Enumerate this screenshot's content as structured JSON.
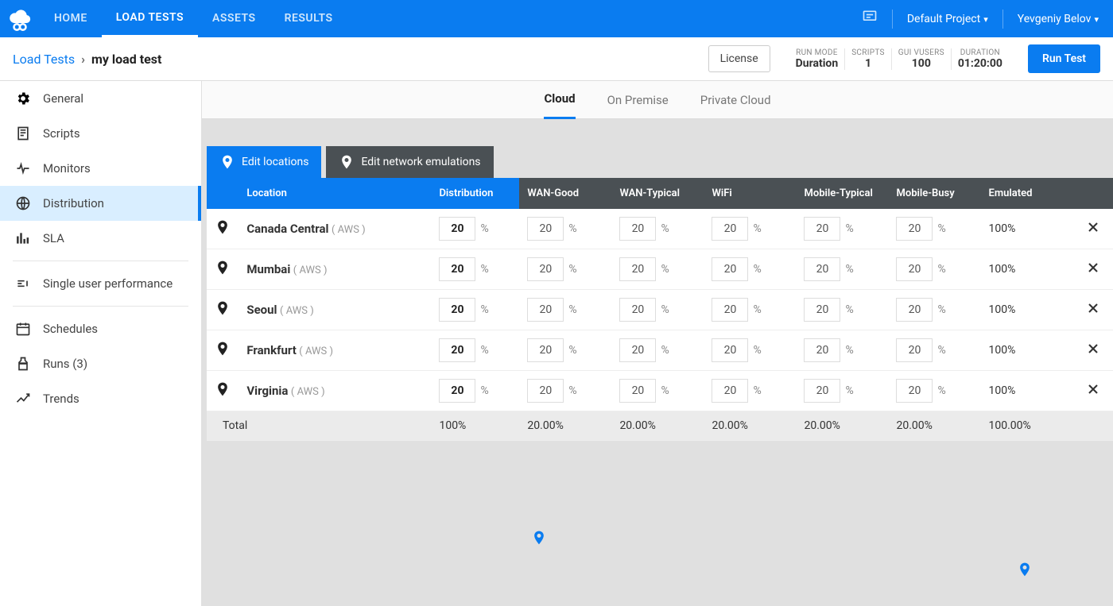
{
  "nav": {
    "items": [
      "HOME",
      "LOAD TESTS",
      "ASSETS",
      "RESULTS"
    ],
    "active": 1,
    "project": "Default Project",
    "user": "Yevgeniy Belov"
  },
  "breadcrumb": {
    "root": "Load Tests",
    "current": "my load test"
  },
  "header": {
    "license": "License",
    "metrics": [
      {
        "label": "RUN MODE",
        "value": "Duration"
      },
      {
        "label": "SCRIPTS",
        "value": "1"
      },
      {
        "label": "GUI VUSERS",
        "value": "100"
      },
      {
        "label": "DURATION",
        "value": "01:20:00"
      }
    ],
    "run": "Run Test"
  },
  "sidebar": {
    "items": [
      {
        "icon": "gear",
        "label": "General"
      },
      {
        "icon": "script",
        "label": "Scripts"
      },
      {
        "icon": "monitor",
        "label": "Monitors"
      },
      {
        "icon": "globe",
        "label": "Distribution"
      },
      {
        "icon": "sla",
        "label": "SLA"
      }
    ],
    "items2": [
      {
        "icon": "single",
        "label": "Single user performance"
      }
    ],
    "items3": [
      {
        "icon": "schedule",
        "label": "Schedules"
      },
      {
        "icon": "runs",
        "label": "Runs (3)"
      },
      {
        "icon": "trends",
        "label": "Trends"
      }
    ],
    "active": 3
  },
  "tabs": {
    "items": [
      "Cloud",
      "On Premise",
      "Private Cloud"
    ],
    "active": 0
  },
  "buttons": {
    "editLocations": "Edit locations",
    "editNetwork": "Edit network emulations"
  },
  "table": {
    "headers": [
      "Location",
      "Distribution",
      "WAN-Good",
      "WAN-Typical",
      "WiFi",
      "Mobile-Typical",
      "Mobile-Busy",
      "Emulated"
    ],
    "rows": [
      {
        "name": "Canada Central",
        "provider": "( AWS )",
        "dist": "20",
        "wan_good": "20",
        "wan_typical": "20",
        "wifi": "20",
        "mob_typical": "20",
        "mob_busy": "20",
        "emulated": "100%"
      },
      {
        "name": "Mumbai",
        "provider": "( AWS )",
        "dist": "20",
        "wan_good": "20",
        "wan_typical": "20",
        "wifi": "20",
        "mob_typical": "20",
        "mob_busy": "20",
        "emulated": "100%"
      },
      {
        "name": "Seoul",
        "provider": "( AWS )",
        "dist": "20",
        "wan_good": "20",
        "wan_typical": "20",
        "wifi": "20",
        "mob_typical": "20",
        "mob_busy": "20",
        "emulated": "100%"
      },
      {
        "name": "Frankfurt",
        "provider": "( AWS )",
        "dist": "20",
        "wan_good": "20",
        "wan_typical": "20",
        "wifi": "20",
        "mob_typical": "20",
        "mob_busy": "20",
        "emulated": "100%"
      },
      {
        "name": "Virginia",
        "provider": "( AWS )",
        "dist": "20",
        "wan_good": "20",
        "wan_typical": "20",
        "wifi": "20",
        "mob_typical": "20",
        "mob_busy": "20",
        "emulated": "100%"
      }
    ],
    "total": {
      "label": "Total",
      "dist": "100%",
      "wan_good": "20.00%",
      "wan_typical": "20.00%",
      "wifi": "20.00%",
      "mob_typical": "20.00%",
      "mob_busy": "20.00%",
      "emulated": "100.00%"
    }
  }
}
